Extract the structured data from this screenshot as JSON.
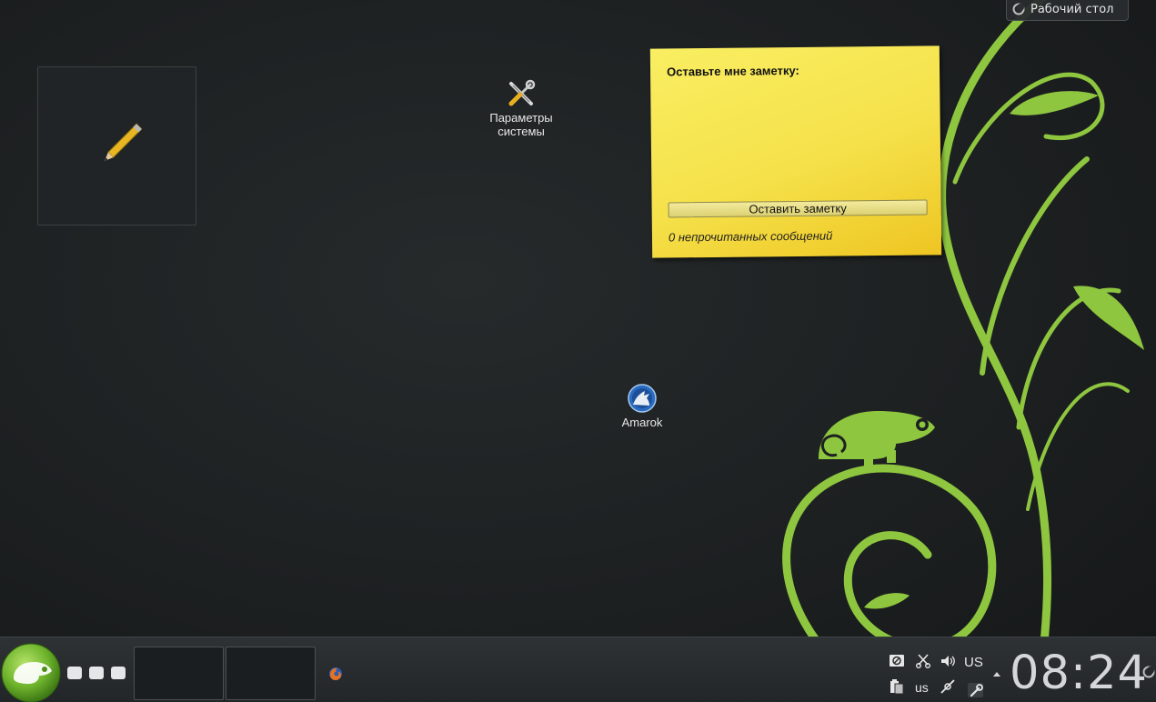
{
  "desktop": {
    "cashew_label": "Рабочий стол",
    "icons": [
      {
        "label_line1": "Параметры",
        "label_line2": "системы",
        "icon": "settings-tools-icon"
      },
      {
        "label": "Amarok",
        "icon": "amarok-wolf-icon"
      }
    ]
  },
  "note_widget": {
    "icon": "pencil-icon"
  },
  "sticky_note": {
    "title": "Оставьте мне заметку:",
    "text": "",
    "button_label": "Оставить заметку",
    "status": "0 непрочитанных сообщений"
  },
  "panel": {
    "launcher_icon": "opensuse-gecko-icon",
    "activities": 3,
    "pager_desktops": 2,
    "task_icon": "firefox-icon",
    "tray": {
      "top_row": [
        "display-icon",
        "scissors-icon",
        "volume-icon"
      ],
      "top_layout": "US",
      "bottom_row": [
        "clipboard-icon",
        "network-icon",
        "wrench-icon"
      ],
      "bottom_layout": "us"
    },
    "clock": "08:24"
  },
  "colors": {
    "accent_green": "#8cc43f",
    "sticky_yellow": "#f5e14a",
    "panel_bg": "#2a2e30"
  }
}
